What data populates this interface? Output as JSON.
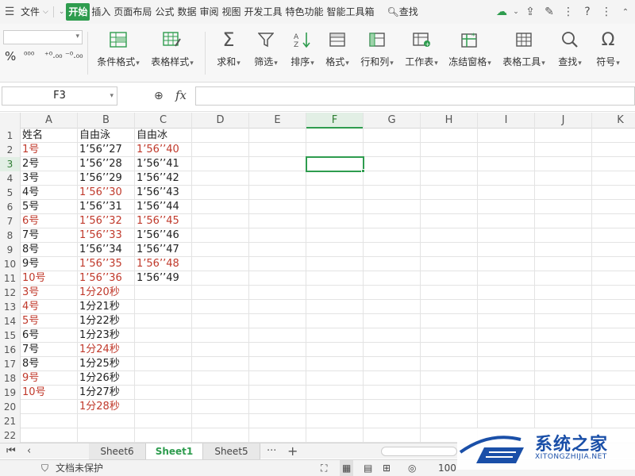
{
  "menubar": {
    "file_label": "文件",
    "tabs": [
      {
        "label": "开始",
        "active": true
      },
      {
        "label": "插入",
        "active": false
      },
      {
        "label": "页面布局",
        "active": false
      },
      {
        "label": "公式",
        "active": false
      },
      {
        "label": "数据",
        "active": false
      },
      {
        "label": "审阅",
        "active": false
      },
      {
        "label": "视图",
        "active": false
      },
      {
        "label": "开发工具",
        "active": false
      },
      {
        "label": "特色功能",
        "active": false
      },
      {
        "label": "智能工具箱",
        "active": false
      }
    ],
    "search_label": "查找"
  },
  "ribbon": {
    "number_formats": [
      "%",
      "000",
      "+.0 .00",
      "-.0 .00"
    ],
    "number_format_labels": [
      "%",
      "⁰⁰⁰",
      "⁺⁰.₀₀",
      "⁻⁰.₀₀"
    ],
    "groups": [
      {
        "label": "条件格式",
        "icon": "conditional-format-icon"
      },
      {
        "label": "表格样式",
        "icon": "table-style-icon"
      },
      {
        "label": "求和",
        "icon": "sum-icon"
      },
      {
        "label": "筛选",
        "icon": "filter-icon"
      },
      {
        "label": "排序",
        "icon": "sort-icon"
      },
      {
        "label": "格式",
        "icon": "format-icon"
      },
      {
        "label": "行和列",
        "icon": "row-col-icon"
      },
      {
        "label": "工作表",
        "icon": "worksheet-icon"
      },
      {
        "label": "冻结窗格",
        "icon": "freeze-panes-icon"
      },
      {
        "label": "表格工具",
        "icon": "table-tools-icon"
      },
      {
        "label": "查找",
        "icon": "find-icon"
      },
      {
        "label": "符号",
        "icon": "symbol-icon"
      }
    ]
  },
  "formula_bar": {
    "cell_ref": "F3",
    "fx_label": "fx",
    "formula": ""
  },
  "sheet": {
    "columns": [
      "A",
      "B",
      "C",
      "D",
      "E",
      "F",
      "G",
      "H",
      "I",
      "J",
      "K"
    ],
    "selected_column": "F",
    "selected_row": 3,
    "row_numbers": [
      "1",
      "2",
      "3",
      "4",
      "5",
      "6",
      "7",
      "8",
      "9",
      "10",
      "11",
      "12",
      "13",
      "14",
      "15",
      "16",
      "17",
      "18",
      "19",
      "20",
      "21",
      "22"
    ],
    "rows": [
      [
        {
          "v": "姓名"
        },
        {
          "v": "自由泳"
        },
        {
          "v": "自由冰"
        }
      ],
      [
        {
          "v": "1号",
          "red": true
        },
        {
          "v": "1’56’’27"
        },
        {
          "v": "1’56’’40",
          "red": true
        }
      ],
      [
        {
          "v": "2号"
        },
        {
          "v": "1’56’’28"
        },
        {
          "v": "1’56’’41"
        }
      ],
      [
        {
          "v": "3号"
        },
        {
          "v": "1’56’’29"
        },
        {
          "v": "1’56’’42"
        }
      ],
      [
        {
          "v": "4号"
        },
        {
          "v": "1’56’’30",
          "red": true
        },
        {
          "v": "1’56’’43"
        }
      ],
      [
        {
          "v": "5号"
        },
        {
          "v": "1’56’’31"
        },
        {
          "v": "1’56’’44"
        }
      ],
      [
        {
          "v": "6号",
          "red": true
        },
        {
          "v": "1’56’’32",
          "red": true
        },
        {
          "v": "1’56’’45",
          "red": true
        }
      ],
      [
        {
          "v": "7号"
        },
        {
          "v": "1’56’’33",
          "red": true
        },
        {
          "v": "1’56’’46"
        }
      ],
      [
        {
          "v": "8号"
        },
        {
          "v": "1’56’’34"
        },
        {
          "v": "1’56’’47"
        }
      ],
      [
        {
          "v": "9号"
        },
        {
          "v": "1’56’’35",
          "red": true
        },
        {
          "v": "1’56’’48",
          "red": true
        }
      ],
      [
        {
          "v": "10号",
          "red": true
        },
        {
          "v": "1’56’’36",
          "red": true
        },
        {
          "v": "1’56’’49"
        }
      ],
      [
        {
          "v": "3号",
          "red": true
        },
        {
          "v": "1分20秒",
          "red": true
        },
        {
          "v": ""
        }
      ],
      [
        {
          "v": "4号",
          "red": true
        },
        {
          "v": "1分21秒"
        },
        {
          "v": ""
        }
      ],
      [
        {
          "v": "5号",
          "red": true
        },
        {
          "v": "1分22秒"
        },
        {
          "v": ""
        }
      ],
      [
        {
          "v": "6号"
        },
        {
          "v": "1分23秒"
        },
        {
          "v": ""
        }
      ],
      [
        {
          "v": "7号"
        },
        {
          "v": "1分24秒",
          "red": true
        },
        {
          "v": ""
        }
      ],
      [
        {
          "v": "8号"
        },
        {
          "v": "1分25秒"
        },
        {
          "v": ""
        }
      ],
      [
        {
          "v": "9号",
          "red": true
        },
        {
          "v": "1分26秒"
        },
        {
          "v": ""
        }
      ],
      [
        {
          "v": "10号",
          "red": true
        },
        {
          "v": "1分27秒"
        },
        {
          "v": ""
        }
      ],
      [
        {
          "v": ""
        },
        {
          "v": "1分28秒",
          "red": true
        },
        {
          "v": ""
        }
      ],
      [
        {
          "v": ""
        },
        {
          "v": ""
        },
        {
          "v": ""
        }
      ],
      [
        {
          "v": ""
        },
        {
          "v": ""
        },
        {
          "v": ""
        }
      ]
    ]
  },
  "sheet_tabs": {
    "tabs": [
      {
        "label": "Sheet6",
        "active": false
      },
      {
        "label": "Sheet1",
        "active": true
      },
      {
        "label": "Sheet5",
        "active": false
      }
    ],
    "more_label": "···",
    "add_label": "+"
  },
  "status_bar": {
    "protect_label": "文档未保护",
    "zoom": "100"
  },
  "watermark": {
    "title": "系统之家",
    "subtitle": "XITONGZHIJIA.NET"
  },
  "colors": {
    "accent": "#2e9c4e",
    "red_text": "#c0392b",
    "watermark_blue": "#1a4fa8"
  }
}
